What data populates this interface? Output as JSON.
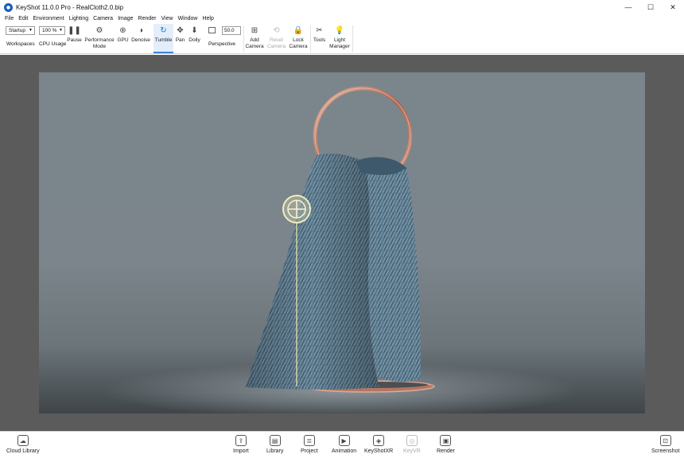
{
  "window": {
    "title": "KeyShot 11.0.0 Pro  - RealCloth2.0.bip",
    "minimize_glyph": "—",
    "maximize_glyph": "☐",
    "close_glyph": "✕"
  },
  "menu": [
    "File",
    "Edit",
    "Environment",
    "Lighting",
    "Camera",
    "Image",
    "Render",
    "View",
    "Window",
    "Help"
  ],
  "ribbon": {
    "workspace_value": "Startup",
    "workspaces_label": "Workspaces",
    "cpu_value": "100 %",
    "cpu_label": "CPU Usage",
    "pause_label": "Pause",
    "performance_label_1": "Performance",
    "performance_label_2": "Mode",
    "gpu_label": "GPU",
    "denoise_label": "Denoise",
    "tumble_label": "Tumble",
    "pan_label": "Pan",
    "dolly_label": "Dolly",
    "fov_value": "50.0",
    "perspective_label": "Perspective",
    "add_camera_1": "Add",
    "add_camera_2": "Camera",
    "reset_camera_1": "Reset",
    "reset_camera_2": "Camera",
    "lock_camera_1": "Lock",
    "lock_camera_2": "Camera",
    "tools_label": "Tools",
    "light_manager_1": "Light",
    "light_manager_2": "Manager"
  },
  "bottom": {
    "cloud_library": "Cloud Library",
    "import": "Import",
    "library": "Library",
    "project": "Project",
    "animation": "Animation",
    "keyshotxr": "KeyShotXR",
    "keyvr": "KeyVR",
    "render": "Render",
    "screenshot": "Screenshot"
  },
  "icons": {
    "pause": "❚❚",
    "performance": "⚙",
    "gpu": "⊕",
    "denoise": "◑",
    "tumble": "↻",
    "pan": "✥",
    "dolly": "⬇",
    "add_camera": "⊞",
    "reset_camera": "⟲",
    "lock_camera": "🔒",
    "tools": "✂",
    "light_manager": "💡",
    "cloud_library": "☁",
    "import": "⇪",
    "library": "▤",
    "project": "≣",
    "animation": "▶",
    "keyshotxr": "◈",
    "keyvr": "◎",
    "render": "▣",
    "screenshot": "⊡"
  },
  "colors": {
    "accent": "#3a86d6",
    "workspace_bg": "#5b5b5b",
    "scene_bg": "#7a858c",
    "cloth": "#4d6a7e",
    "ring": "#c08068"
  }
}
